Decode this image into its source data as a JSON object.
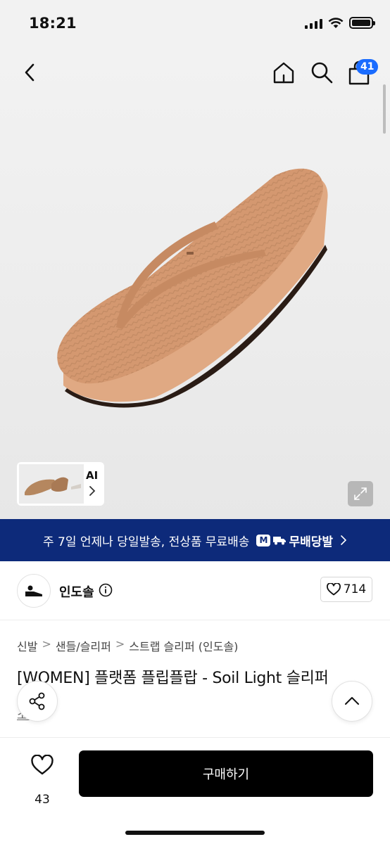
{
  "status_bar": {
    "time": "18:21"
  },
  "nav": {
    "cart_count": "41"
  },
  "gallery": {
    "ai_label": "AI"
  },
  "promo": {
    "text": "주 7일 언제나 당일발송, 전상품 무료배송",
    "service_name": "무배당발",
    "colors": {
      "background": "#0d2a7a"
    }
  },
  "brand": {
    "name": "인도솔",
    "like_count": "714"
  },
  "breadcrumb": [
    "신발",
    "샌들/슬리퍼",
    "스트랩 슬리퍼 (인도솔)"
  ],
  "product": {
    "title": "[WOMEN] 플랫폼 플립플랍 - Soil Light 슬리퍼",
    "partial_text": "소개"
  },
  "bottom_bar": {
    "wish_count": "43",
    "buy_label": "구매하기"
  },
  "colors": {
    "accent": "#1a6cff",
    "buy_button": "#000000"
  }
}
